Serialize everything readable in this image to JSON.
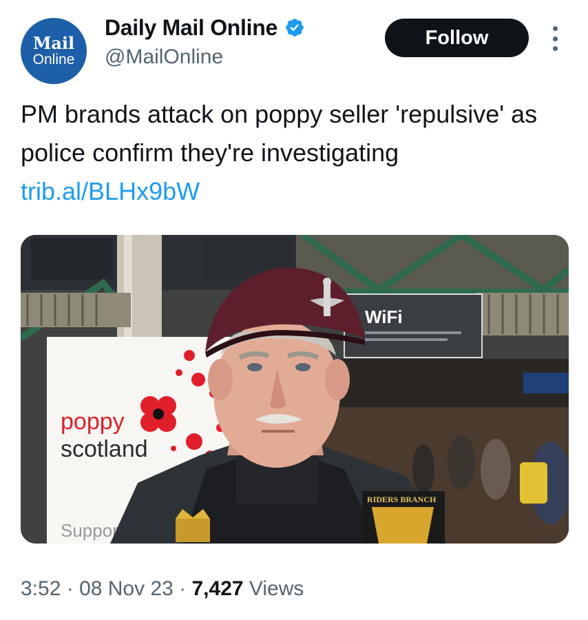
{
  "account": {
    "avatar_line1": "Mail",
    "avatar_line2": "Online",
    "display_name": "Daily Mail Online",
    "handle": "@MailOnline",
    "verified": true,
    "verified_color": "#1d9bf0"
  },
  "follow_label": "Follow",
  "tweet": {
    "text": "PM brands attack on poppy seller 'repulsive' as police confirm they're investigating",
    "link": "trib.al/BLHx9bW"
  },
  "media": {
    "banner_line1": "poppy",
    "banner_line2": "scotland",
    "banner_line3": "Support",
    "wifi_sign": "WiFi",
    "patch_text": "RIDERS BRANCH"
  },
  "meta": {
    "time": "3:52",
    "date": "08 Nov 23",
    "views_count": "7,427",
    "views_label": "Views"
  },
  "colors": {
    "link": "#1d9bf0",
    "secondary_text": "#536471",
    "beret": "#5e1f2c",
    "poppy_red": "#e01f2b"
  }
}
